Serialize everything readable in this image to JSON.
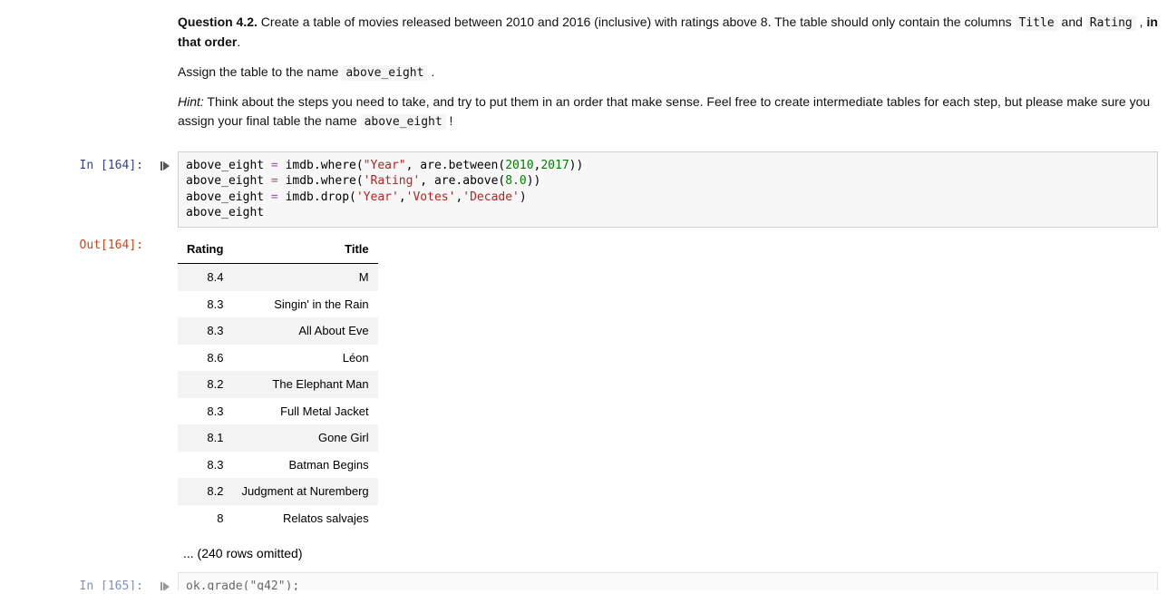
{
  "question": {
    "label": "Question 4.2.",
    "body_1": " Create a table of movies released between 2010 and 2016 (inclusive) with ratings above 8. The table should only contain the columns ",
    "title_code": "Title",
    "body_mid_1": " and ",
    "rating_code": "Rating",
    "body_mid_2": " , ",
    "order_bold": "in that order",
    "period": ".",
    "assign_pre": "Assign the table to the name ",
    "assign_code": "above_eight",
    "assign_post": " .",
    "hint_label": "Hint:",
    "hint_body_1": " Think about the steps you need to take, and try to put them in an order that make sense. Feel free to create intermediate tables for each step, but please make sure you assign your final table the name ",
    "hint_code": "above_eight",
    "hint_excl": " !"
  },
  "cell_in": {
    "prompt": "In [164]:",
    "line1": {
      "a": "above_eight ",
      "op": "=",
      "b": " imdb.where(",
      "s1": "\"Year\"",
      "c": ", are.between(",
      "n1": "2010",
      "comma": ",",
      "n2": "2017",
      "d": "))"
    },
    "line2": {
      "a": "above_eight ",
      "op": "=",
      "b": " imdb.where(",
      "s1": "'Rating'",
      "c": ", are.above(",
      "n1": "8.0",
      "d": "))"
    },
    "line3": {
      "a": "above_eight ",
      "op": "=",
      "b": " imdb.drop(",
      "s1": "'Year'",
      "comma1": ",",
      "s2": "'Votes'",
      "comma2": ",",
      "s3": "'Decade'",
      "d": ")"
    },
    "line4": "above_eight"
  },
  "cell_out": {
    "prompt": "Out[164]:",
    "headers": {
      "c0": "Rating",
      "c1": "Title"
    },
    "rows": [
      {
        "rating": "8.4",
        "title": "M"
      },
      {
        "rating": "8.3",
        "title": "Singin' in the Rain"
      },
      {
        "rating": "8.3",
        "title": "All About Eve"
      },
      {
        "rating": "8.6",
        "title": "Léon"
      },
      {
        "rating": "8.2",
        "title": "The Elephant Man"
      },
      {
        "rating": "8.3",
        "title": "Full Metal Jacket"
      },
      {
        "rating": "8.1",
        "title": "Gone Girl"
      },
      {
        "rating": "8.3",
        "title": "Batman Begins"
      },
      {
        "rating": "8.2",
        "title": "Judgment at Nuremberg"
      },
      {
        "rating": "8",
        "title": "Relatos salvajes"
      }
    ],
    "omitted": "... (240 rows omitted)"
  },
  "next": {
    "prompt": "In [165]:",
    "snippet": "ok.grade(\"q42\");"
  }
}
